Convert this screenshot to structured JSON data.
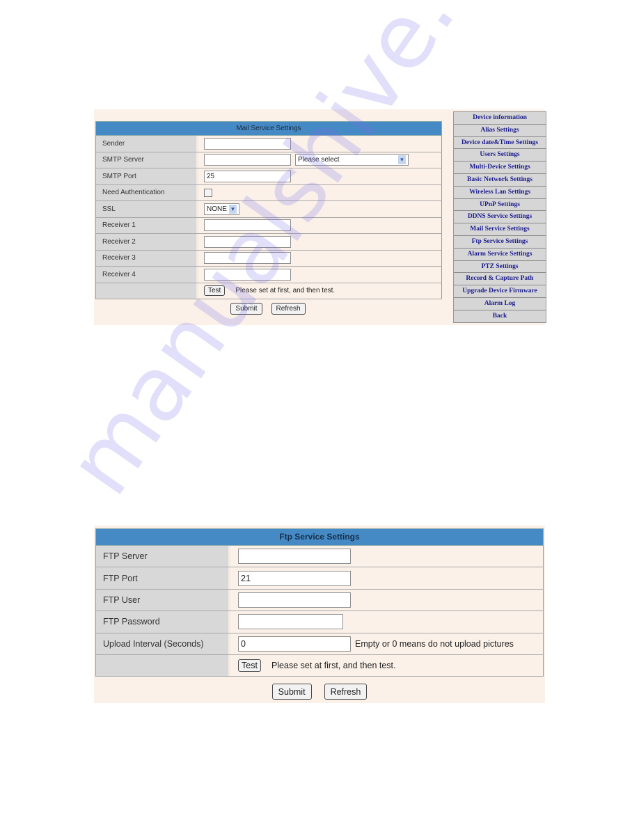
{
  "mail": {
    "title": "Mail Service Settings",
    "fields": {
      "sender": {
        "label": "Sender",
        "value": ""
      },
      "smtp_server": {
        "label": "SMTP Server",
        "value": "",
        "select_value": "Please select"
      },
      "smtp_port": {
        "label": "SMTP Port",
        "value": "25"
      },
      "need_auth": {
        "label": "Need Authentication",
        "checked": false
      },
      "ssl": {
        "label": "SSL",
        "select_value": "NONE"
      },
      "receiver1": {
        "label": "Receiver 1",
        "value": ""
      },
      "receiver2": {
        "label": "Receiver 2",
        "value": ""
      },
      "receiver3": {
        "label": "Receiver 3",
        "value": ""
      },
      "receiver4": {
        "label": "Receiver 4",
        "value": ""
      }
    },
    "test_label": "Test",
    "test_note": "Please set at first, and then test.",
    "submit_label": "Submit",
    "refresh_label": "Refresh"
  },
  "sidebar": {
    "items": [
      {
        "label": "Device information"
      },
      {
        "label": "Alias Settings"
      },
      {
        "label": "Device date&Time Settings"
      },
      {
        "label": "Users Settings"
      },
      {
        "label": "Multi-Device Settings"
      },
      {
        "label": "Basic Network Settings"
      },
      {
        "label": "Wireless Lan Settings"
      },
      {
        "label": "UPnP Settings"
      },
      {
        "label": "DDNS Service Settings"
      },
      {
        "label": "Mail Service Settings"
      },
      {
        "label": "Ftp Service Settings"
      },
      {
        "label": "Alarm Service Settings"
      },
      {
        "label": "PTZ Settings"
      },
      {
        "label": "Record & Capture Path"
      },
      {
        "label": "Upgrade Device Firmware"
      },
      {
        "label": "Alarm Log"
      },
      {
        "label": "Back"
      }
    ]
  },
  "ftp": {
    "title": "Ftp Service Settings",
    "fields": {
      "server": {
        "label": "FTP Server",
        "value": ""
      },
      "port": {
        "label": "FTP Port",
        "value": "21"
      },
      "user": {
        "label": "FTP User",
        "value": ""
      },
      "password": {
        "label": "FTP Password",
        "value": ""
      },
      "interval": {
        "label": "Upload Interval (Seconds)",
        "value": "0",
        "note": "Empty or 0 means do not upload pictures"
      }
    },
    "test_label": "Test",
    "test_note": "Please set at first, and then test.",
    "submit_label": "Submit",
    "refresh_label": "Refresh"
  },
  "watermark": "manualshive.com",
  "colors": {
    "header": "#468ac5",
    "label_bg": "#d8d8d8",
    "value_bg": "#fbf1e9",
    "sidebar_text": "#1c1c8e"
  }
}
